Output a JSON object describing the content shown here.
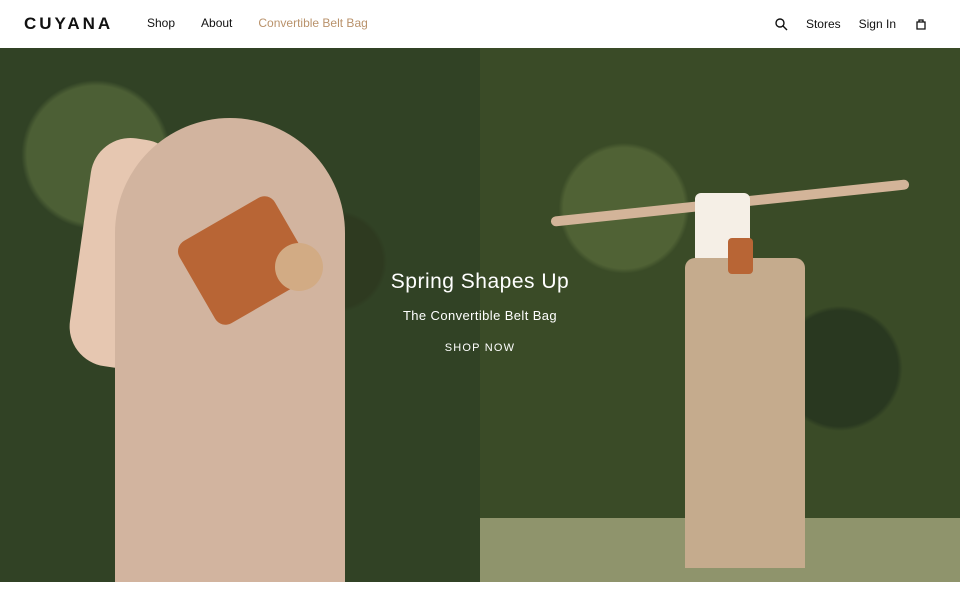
{
  "header": {
    "logo": "CUYANA",
    "nav": [
      "Shop",
      "About",
      "Convertible Belt Bag"
    ],
    "stores": "Stores",
    "sign_in": "Sign In",
    "icons": {
      "search": "search-icon",
      "cart": "bag-icon"
    }
  },
  "hero": {
    "title": "Spring Shapes Up",
    "subtitle": "The Convertible Belt Bag",
    "cta": "SHOP NOW"
  }
}
